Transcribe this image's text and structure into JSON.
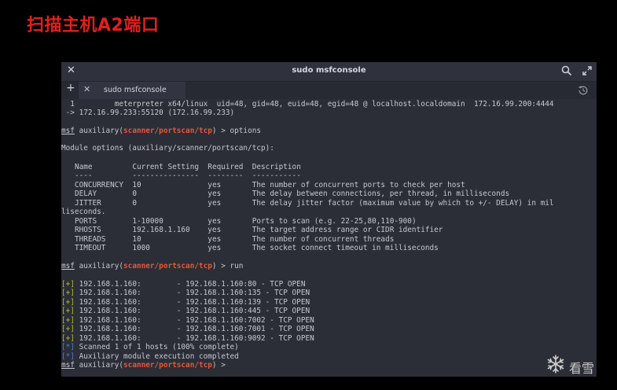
{
  "slide": {
    "title": "扫描主机A2端口"
  },
  "window": {
    "title": "sudo msfconsole"
  },
  "tabs": [
    {
      "label": "sudo msfconsole"
    }
  ],
  "session_line": {
    "id": "1",
    "type": "meterpreter x64/linux",
    "info": "uid=48, gid=48, euid=48, egid=48 @ localhost.localdomain",
    "conn_start": "172.16.99.200:4444",
    "conn_end": "-> 172.16.99.233:55120 (172.16.99.233)"
  },
  "prompt": {
    "prefix": "msf",
    "text": " auxiliary(",
    "module": "scanner/portscan/tcp",
    "suffix": ") > "
  },
  "commands": {
    "options": "options",
    "run": "run"
  },
  "module_options_header": "Module options (auxiliary/scanner/portscan/tcp):",
  "options_table": {
    "headers": [
      "Name",
      "Current Setting",
      "Required",
      "Description"
    ],
    "underlines": [
      "----",
      "---------------",
      "--------",
      "-----------"
    ],
    "rows": [
      {
        "name": "CONCURRENCY",
        "setting": "10",
        "required": "yes",
        "description": "The number of concurrent ports to check per host"
      },
      {
        "name": "DELAY",
        "setting": "0",
        "required": "yes",
        "description": "The delay between connections, per thread, in milliseconds"
      },
      {
        "name": "JITTER",
        "setting": "0",
        "required": "yes",
        "description": "The delay jitter factor (maximum value by which to +/- DELAY) in mil"
      },
      {
        "name": "PORTS",
        "setting": "1-10000",
        "required": "yes",
        "description": "Ports to scan (e.g. 22-25,80,110-900)"
      },
      {
        "name": "RHOSTS",
        "setting": "192.168.1.160",
        "required": "yes",
        "description": "The target address range or CIDR identifier"
      },
      {
        "name": "THREADS",
        "setting": "10",
        "required": "yes",
        "description": "The number of concurrent threads"
      },
      {
        "name": "TIMEOUT",
        "setting": "1000",
        "required": "yes",
        "description": "The socket connect timeout in milliseconds"
      }
    ],
    "wrap": "liseconds."
  },
  "scan_results": [
    {
      "marker": "[+]",
      "host": "192.168.1.160:",
      "result": "- 192.168.1.160:80 - TCP OPEN"
    },
    {
      "marker": "[+]",
      "host": "192.168.1.160:",
      "result": "- 192.168.1.160:135 - TCP OPEN"
    },
    {
      "marker": "[+]",
      "host": "192.168.1.160:",
      "result": "- 192.168.1.160:139 - TCP OPEN"
    },
    {
      "marker": "[+]",
      "host": "192.168.1.160:",
      "result": "- 192.168.1.160:445 - TCP OPEN"
    },
    {
      "marker": "[+]",
      "host": "192.168.1.160:",
      "result": "- 192.168.1.160:7002 - TCP OPEN"
    },
    {
      "marker": "[+]",
      "host": "192.168.1.160:",
      "result": "- 192.168.1.160:7001 - TCP OPEN"
    },
    {
      "marker": "[+]",
      "host": "192.168.1.160:",
      "result": "- 192.168.1.160:9092 - TCP OPEN"
    }
  ],
  "status_lines": [
    {
      "marker": "[*]",
      "text": "Scanned 1 of 1 hosts (100% complete)"
    },
    {
      "marker": "[*]",
      "text": "Auxiliary module execution completed"
    }
  ],
  "watermark": {
    "text": "看雪"
  },
  "icons": {
    "close": "close-icon",
    "search": "search-icon",
    "maximize": "maximize-icon",
    "new_tab": "plus-icon",
    "tab_close": "close-icon",
    "history": "history-icon",
    "watermark_logo": "snowflake-icon"
  },
  "colors": {
    "slide_title": "#e0201d",
    "terminal_bg": "#2b2e37",
    "terminal_text": "#c6c8ce",
    "module_highlight": "#e4583b",
    "success_marker": "#b6bc2a",
    "info_marker": "#4f7bd8"
  }
}
